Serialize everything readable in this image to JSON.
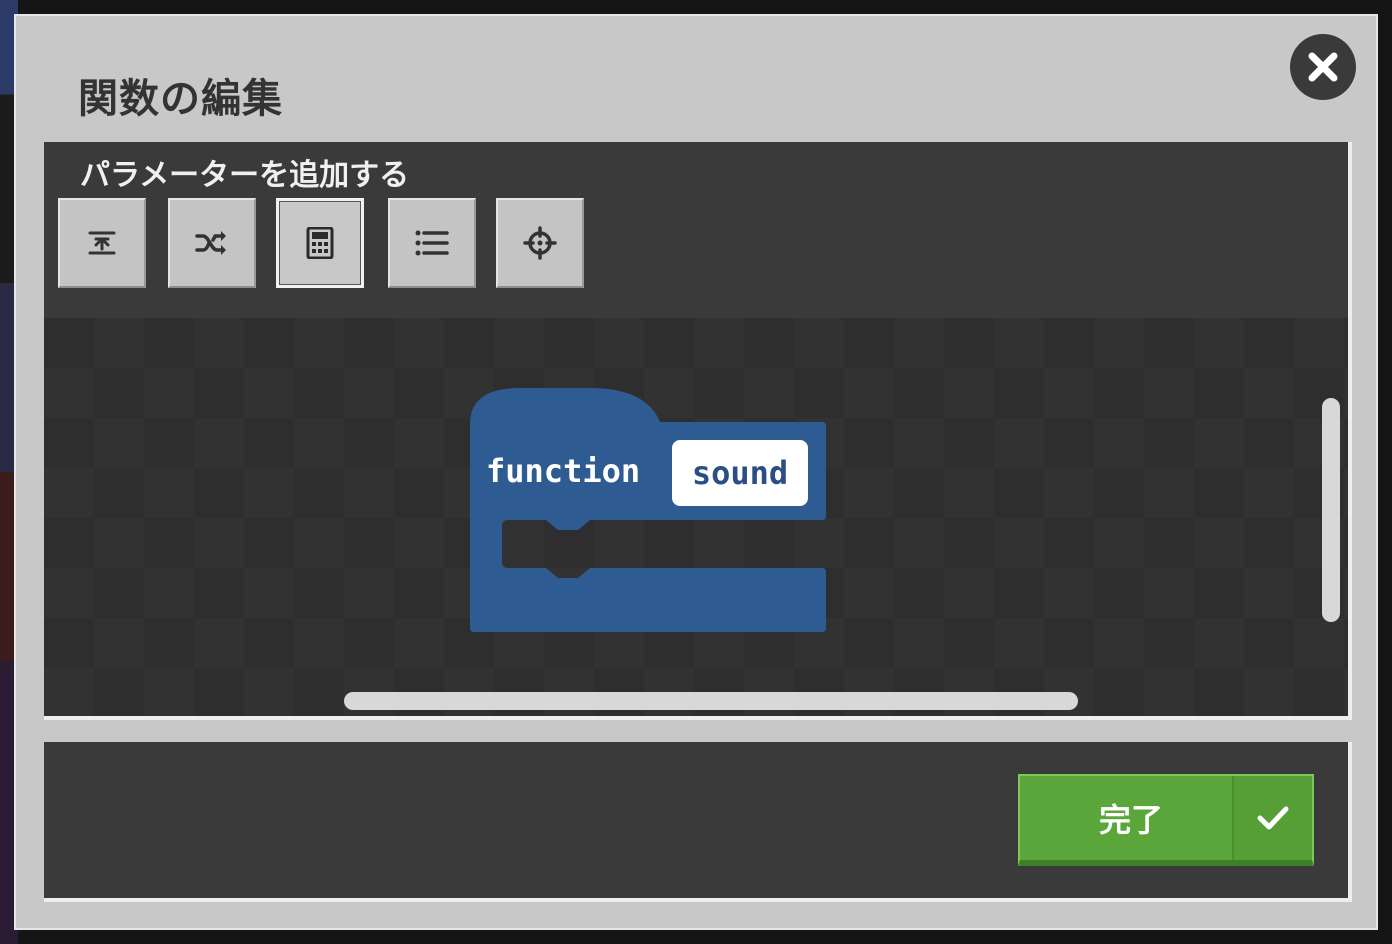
{
  "dialog": {
    "title": "関数の編集",
    "close_icon": "close-icon"
  },
  "editor": {
    "add_parameter_label": "パラメーターを追加する",
    "parameter_buttons": [
      {
        "type": "text",
        "icon": "text-icon",
        "selected": false
      },
      {
        "type": "boolean",
        "icon": "shuffle-icon",
        "selected": false
      },
      {
        "type": "number",
        "icon": "calculator-icon",
        "selected": true
      },
      {
        "type": "array",
        "icon": "list-icon",
        "selected": false
      },
      {
        "type": "sprite",
        "icon": "crosshair-icon",
        "selected": false
      }
    ],
    "block": {
      "keyword": "function",
      "name": "sound",
      "color": "#2f5b93"
    }
  },
  "footer": {
    "done_label": "完了",
    "done_icon": "check-icon",
    "done_color": "#5aa63b"
  }
}
